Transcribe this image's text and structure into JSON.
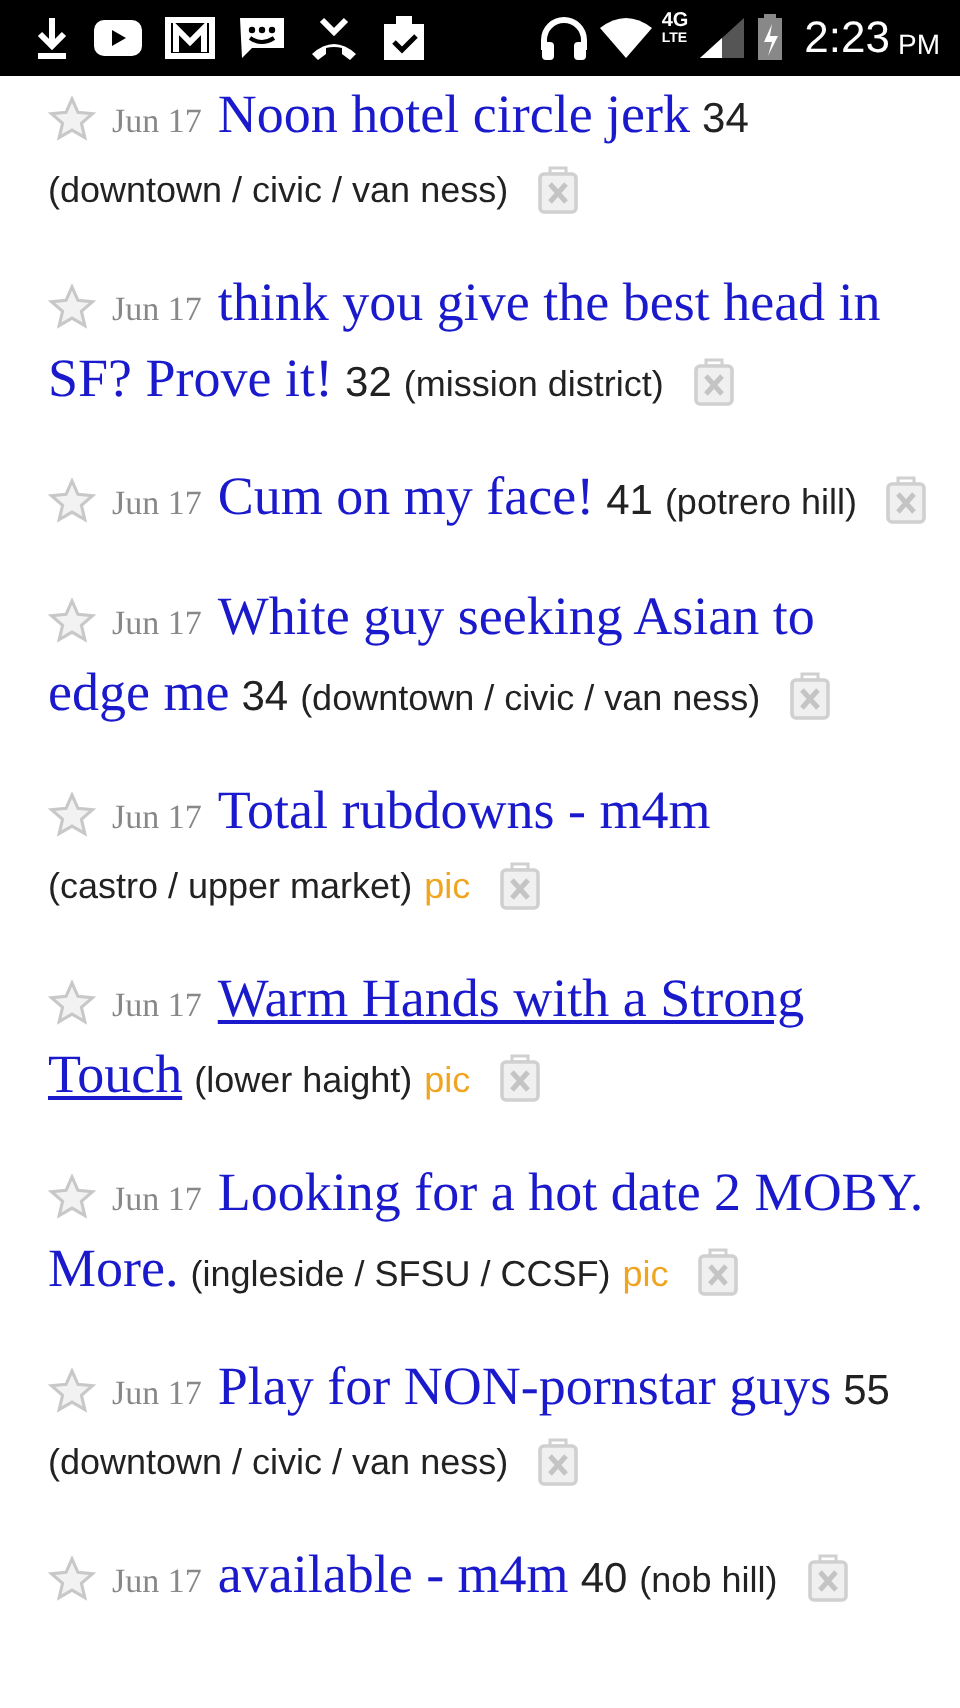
{
  "status_bar": {
    "network": "4G",
    "network_sub": "LTE",
    "time": "2:23",
    "ampm": "PM"
  },
  "posts": [
    {
      "date": "Jun 17",
      "title": [
        "Noon hotel circle jerk"
      ],
      "price": "34",
      "location": "(downtown / civic / van ness)",
      "focused": false
    },
    {
      "date": "Jun 17",
      "title": [
        "think you give the best head in",
        "SF? Prove it!"
      ],
      "price": "32",
      "location": "(mission district)",
      "focused": false
    },
    {
      "date": "Jun 17",
      "title": [
        "Cum on my face!"
      ],
      "price": "41",
      "location": "(potrero hill)",
      "focused": false
    },
    {
      "date": "Jun 17",
      "title": [
        "White guy seeking Asian to",
        "edge me"
      ],
      "price": "34",
      "location": "(downtown / civic / van ness)",
      "focused": false
    },
    {
      "date": "Jun 17",
      "title": [
        "Total rubdowns - m4m"
      ],
      "location": "(castro / upper market)",
      "pic": "pic",
      "focused": false
    },
    {
      "date": "Jun 17",
      "title": [
        "Warm Hands with a Strong",
        "Touch"
      ],
      "location": "(lower haight)",
      "pic": "pic",
      "focused": true
    },
    {
      "date": "Jun 17",
      "title": [
        "Looking for a hot date 2 MOBY.",
        "More."
      ],
      "location": "(ingleside / SFSU / CCSF)",
      "pic": "pic",
      "focused": false
    },
    {
      "date": "Jun 17",
      "title": [
        "Play for NON-pornstar guys"
      ],
      "price": "55",
      "location": "(downtown / civic / van ness)",
      "focused": false
    },
    {
      "date": "Jun 17",
      "title": [
        "available - m4m"
      ],
      "price": "40",
      "location": "(nob hill)",
      "focused": false
    }
  ]
}
